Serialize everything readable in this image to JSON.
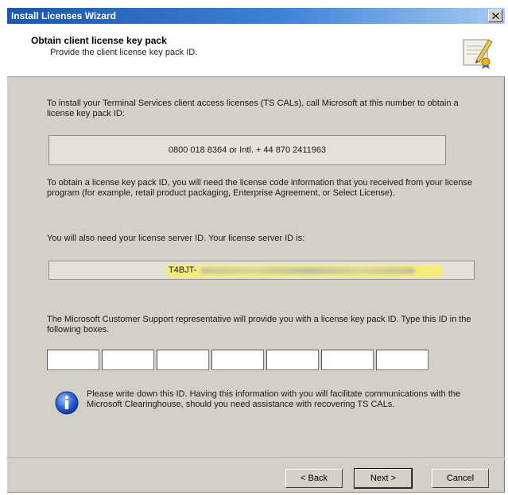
{
  "window": {
    "title": "Install Licenses Wizard"
  },
  "header": {
    "title": "Obtain client license key pack",
    "subtitle": "Provide the client license key pack ID."
  },
  "body": {
    "intro": "To install your Terminal Services client access licenses (TS CALs), call Microsoft at this number to obtain a license key pack ID:",
    "phone": "0800 018 8364 or Intl. + 44 870 2411963",
    "license_info": "To obtain a license key pack ID, you will need the license code information that you received from your license program (for example, retail product packaging, Enterprise Agreement, or Select License).",
    "server_id_label": "You will also need your license server ID. Your license server ID is:",
    "server_id_prefix": "T4BJT-",
    "support_text": "The Microsoft Customer Support representative will provide you with a license key pack ID. Type this ID in the following boxes.",
    "key_boxes": [
      "",
      "",
      "",
      "",
      "",
      "",
      ""
    ],
    "note": "Please write down this ID. Having this information with you will facilitate communications with the Microsoft Clearinghouse, should you need assistance with recovering TS CALs."
  },
  "buttons": {
    "back": "< Back",
    "next": "Next >",
    "cancel": "Cancel"
  },
  "colors": {
    "titlebar": "#1d55b0",
    "highlight": "#f7ef6a",
    "dialog": "#d4d0c8"
  },
  "icons": {
    "header": "license-certificate-icon",
    "info": "info-icon",
    "close": "close-icon"
  }
}
